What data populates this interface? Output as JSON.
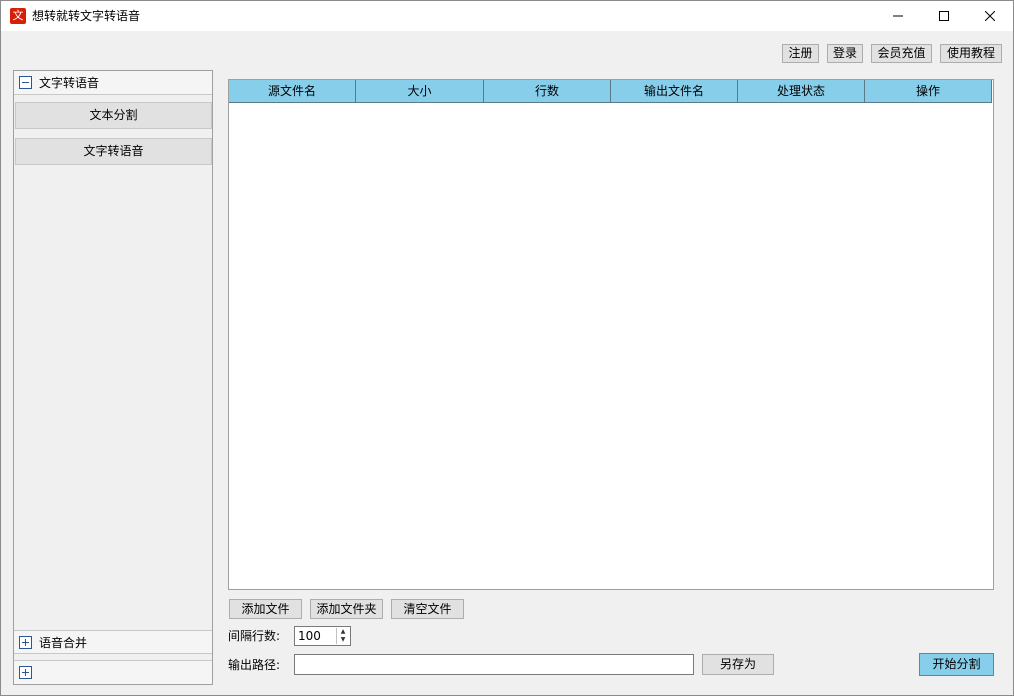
{
  "window": {
    "app_icon_glyph": "文",
    "title": "想转就转文字转语音"
  },
  "top_buttons": {
    "register": "注册",
    "login": "登录",
    "recharge": "会员充值",
    "tutorial": "使用教程"
  },
  "sidebar": {
    "groups": [
      {
        "label": "文字转语音",
        "expanded": true,
        "items": [
          "文本分割",
          "文字转语音"
        ]
      },
      {
        "label": "语音合并",
        "expanded": false
      },
      {
        "label": "",
        "expanded": false
      }
    ]
  },
  "table": {
    "columns": [
      "源文件名",
      "大小",
      "行数",
      "输出文件名",
      "处理状态",
      "操作"
    ],
    "rows": []
  },
  "actions": {
    "add_file": "添加文件",
    "add_folder": "添加文件夹",
    "clear_files": "清空文件"
  },
  "interval": {
    "label": "间隔行数:",
    "value": "100"
  },
  "output": {
    "label": "输出路径:",
    "value": "",
    "save_as": "另存为"
  },
  "start_label": "开始分割",
  "colors": {
    "header_bg": "#87ceeb",
    "start_button": "#87ceeb",
    "app_icon": "#d81e06"
  }
}
